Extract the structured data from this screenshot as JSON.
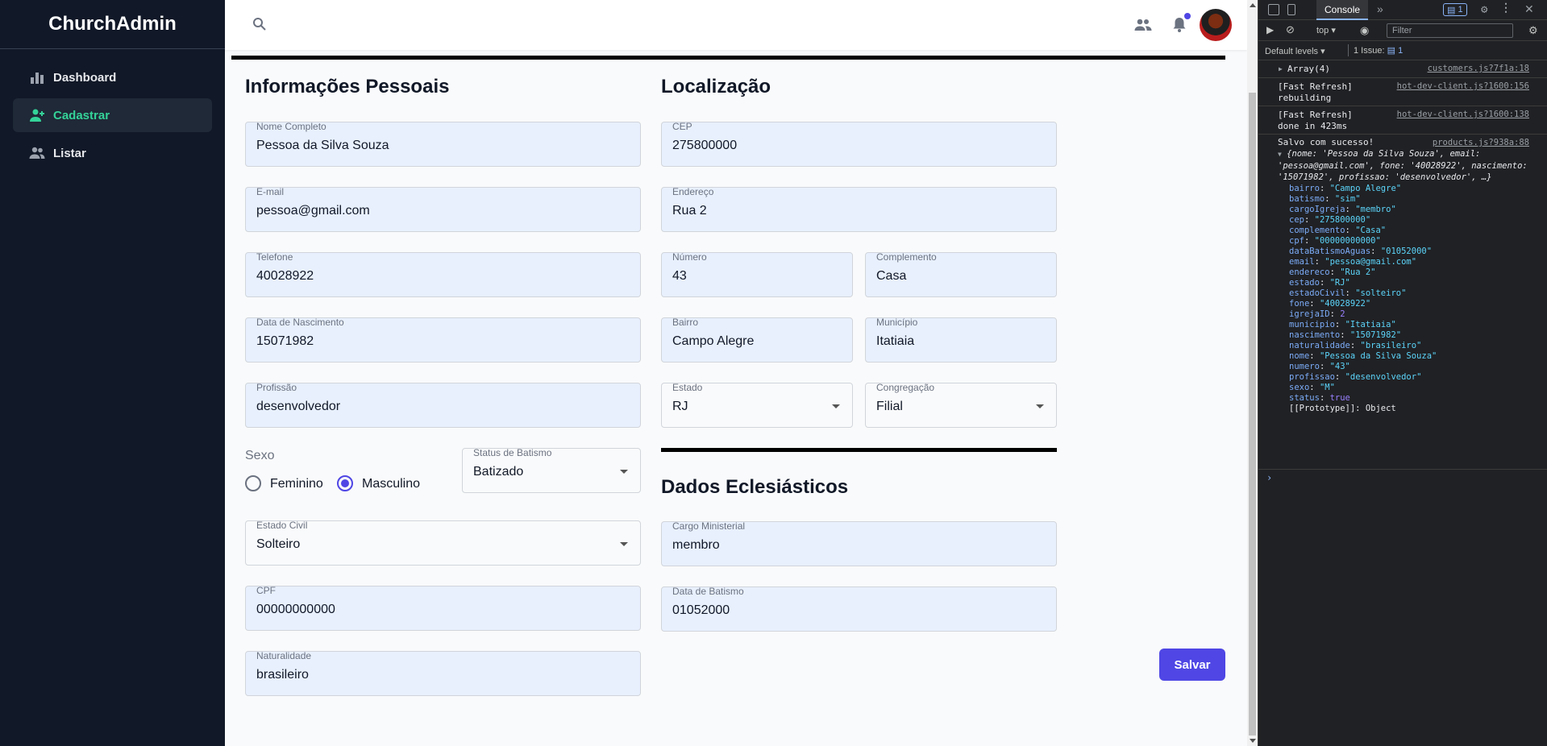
{
  "app": {
    "brand": "ChurchAdmin"
  },
  "sidebar": {
    "items": [
      {
        "label": "Dashboard",
        "icon": "bar-chart-icon"
      },
      {
        "label": "Cadastrar",
        "icon": "user-plus-icon"
      },
      {
        "label": "Listar",
        "icon": "users-icon"
      }
    ]
  },
  "colors": {
    "sidebar_bg": "#111827",
    "active_accent": "#34d399",
    "primary": "#4f46e5",
    "field_bg": "#e8f0fe"
  },
  "form": {
    "personal_title": "Informações Pessoais",
    "location_title": "Localização",
    "ecclesiastic_title": "Dados Eclesiásticos",
    "nome": {
      "label": "Nome Completo",
      "value": "Pessoa da Silva Souza"
    },
    "email": {
      "label": "E-mail",
      "value": "pessoa@gmail.com"
    },
    "telefone": {
      "label": "Telefone",
      "value": "40028922"
    },
    "nascimento": {
      "label": "Data de Nascimento",
      "value": "15071982"
    },
    "profissao": {
      "label": "Profissão",
      "value": "desenvolvedor"
    },
    "sexo": {
      "label": "Sexo",
      "options": [
        "Feminino",
        "Masculino"
      ],
      "selected": "Masculino"
    },
    "status_batismo": {
      "label": "Status de Batismo",
      "value": "Batizado"
    },
    "estado_civil": {
      "label": "Estado Civil",
      "value": "Solteiro"
    },
    "cpf": {
      "label": "CPF",
      "value": "00000000000"
    },
    "naturalidade": {
      "label": "Naturalidade",
      "value": "brasileiro"
    },
    "cep": {
      "label": "CEP",
      "value": "275800000"
    },
    "endereco": {
      "label": "Endereço",
      "value": "Rua 2"
    },
    "numero": {
      "label": "Número",
      "value": "43"
    },
    "complemento": {
      "label": "Complemento",
      "value": "Casa"
    },
    "bairro": {
      "label": "Bairro",
      "value": "Campo Alegre"
    },
    "municipio": {
      "label": "Município",
      "value": "Itatiaia"
    },
    "estado": {
      "label": "Estado",
      "value": "RJ"
    },
    "congregacao": {
      "label": "Congregação",
      "value": "Filial"
    },
    "cargo": {
      "label": "Cargo Ministerial",
      "value": "membro"
    },
    "data_batismo": {
      "label": "Data de Batismo",
      "value": "01052000"
    },
    "save_label": "Salvar"
  },
  "devtools": {
    "tab_console": "Console",
    "badge_count": "1",
    "context": "top",
    "filter_placeholder": "Filter",
    "levels": "Default levels",
    "issues": "1 Issue:",
    "issues_count": "1",
    "logs": [
      {
        "text": "Array(4)",
        "source": "customers.js?7f1a:18"
      },
      {
        "text": "[Fast Refresh] rebuilding",
        "source": "hot-dev-client.js?1600:156"
      },
      {
        "text": "[Fast Refresh] done in 423ms",
        "source": "hot-dev-client.js?1600:138"
      },
      {
        "text": "Salvo com sucesso!",
        "source": "products.js?938a:88"
      }
    ],
    "object_summary": "{nome: 'Pessoa da Silva Souza', email: 'pessoa@gmail.com', fone: '40028922', nascimento: '15071982', profissao: 'desenvolvedor', …}",
    "object_props": [
      {
        "key": "bairro",
        "value": "\"Campo Alegre\""
      },
      {
        "key": "batismo",
        "value": "\"sim\""
      },
      {
        "key": "cargoIgreja",
        "value": "\"membro\""
      },
      {
        "key": "cep",
        "value": "\"275800000\""
      },
      {
        "key": "complemento",
        "value": "\"Casa\""
      },
      {
        "key": "cpf",
        "value": "\"00000000000\""
      },
      {
        "key": "dataBatismoAguas",
        "value": "\"01052000\""
      },
      {
        "key": "email",
        "value": "\"pessoa@gmail.com\""
      },
      {
        "key": "endereco",
        "value": "\"Rua 2\""
      },
      {
        "key": "estado",
        "value": "\"RJ\""
      },
      {
        "key": "estadoCivil",
        "value": "\"solteiro\""
      },
      {
        "key": "fone",
        "value": "\"40028922\""
      },
      {
        "key": "igrejaID",
        "value": "2"
      },
      {
        "key": "municipio",
        "value": "\"Itatiaia\""
      },
      {
        "key": "nascimento",
        "value": "\"15071982\""
      },
      {
        "key": "naturalidade",
        "value": "\"brasileiro\""
      },
      {
        "key": "nome",
        "value": "\"Pessoa da Silva Souza\""
      },
      {
        "key": "numero",
        "value": "\"43\""
      },
      {
        "key": "profissao",
        "value": "\"desenvolvedor\""
      },
      {
        "key": "sexo",
        "value": "\"M\""
      },
      {
        "key": "status",
        "value": "true"
      }
    ],
    "prototype": "[[Prototype]]: Object"
  }
}
